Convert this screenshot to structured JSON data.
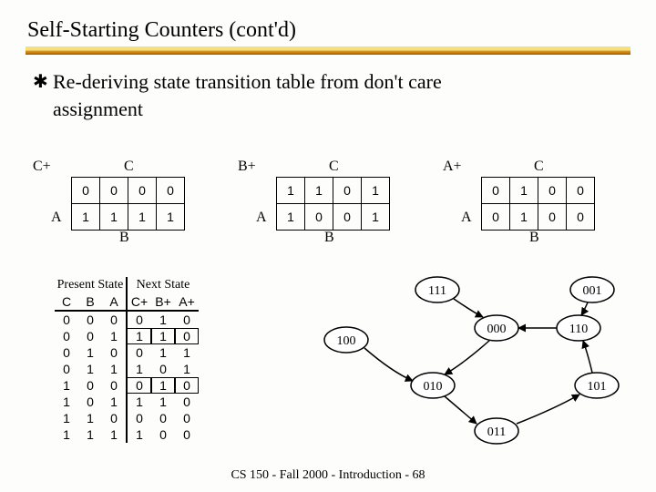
{
  "title": "Self-Starting Counters (cont'd)",
  "bullet_line1": "Re-deriving state transition table from don't care",
  "bullet_line2": "assignment",
  "kmap_labels": {
    "c": "C",
    "a": "A",
    "b": "B"
  },
  "kmaps": [
    {
      "flabel": "C+",
      "cells": [
        [
          "0",
          "0",
          "0",
          "0"
        ],
        [
          "1",
          "1",
          "1",
          "1"
        ]
      ]
    },
    {
      "flabel": "B+",
      "cells": [
        [
          "1",
          "1",
          "0",
          "1"
        ],
        [
          "1",
          "0",
          "0",
          "1"
        ]
      ]
    },
    {
      "flabel": "A+",
      "cells": [
        [
          "0",
          "1",
          "0",
          "0"
        ],
        [
          "0",
          "1",
          "0",
          "0"
        ]
      ]
    }
  ],
  "stt": {
    "group_left": "Present State",
    "group_right": "Next State",
    "headers_left": [
      "C",
      "B",
      "A"
    ],
    "headers_right": [
      "C+",
      "B+",
      "A+"
    ],
    "rows": [
      [
        "0",
        "0",
        "0",
        "0",
        "1",
        "0"
      ],
      [
        "0",
        "0",
        "1",
        "1",
        "1",
        "0"
      ],
      [
        "0",
        "1",
        "0",
        "0",
        "1",
        "1"
      ],
      [
        "0",
        "1",
        "1",
        "1",
        "0",
        "1"
      ],
      [
        "1",
        "0",
        "0",
        "0",
        "1",
        "0"
      ],
      [
        "1",
        "0",
        "1",
        "1",
        "1",
        "0"
      ],
      [
        "1",
        "1",
        "0",
        "0",
        "0",
        "0"
      ],
      [
        "1",
        "1",
        "1",
        "1",
        "0",
        "0"
      ]
    ],
    "mark_rows": [
      1,
      4
    ]
  },
  "states": {
    "n100": "100",
    "n111": "111",
    "n001": "001",
    "n000": "000",
    "n110": "110",
    "n010": "010",
    "n101": "101",
    "n011": "011"
  },
  "footer": "CS 150 - Fall 2000 - Introduction - 68",
  "chart_data": {
    "type": "table",
    "title": "Self-Starting Counters state transition",
    "kmaps": [
      {
        "output": "C+",
        "grid": [
          [
            0,
            0,
            0,
            0
          ],
          [
            1,
            1,
            1,
            1
          ]
        ]
      },
      {
        "output": "B+",
        "grid": [
          [
            1,
            1,
            0,
            1
          ],
          [
            1,
            0,
            0,
            1
          ]
        ]
      },
      {
        "output": "A+",
        "grid": [
          [
            0,
            1,
            0,
            0
          ],
          [
            0,
            1,
            0,
            0
          ]
        ]
      }
    ],
    "state_table": {
      "columns": [
        "C",
        "B",
        "A",
        "C+",
        "B+",
        "A+"
      ],
      "rows": [
        [
          0,
          0,
          0,
          0,
          1,
          0
        ],
        [
          0,
          0,
          1,
          1,
          1,
          0
        ],
        [
          0,
          1,
          0,
          0,
          1,
          1
        ],
        [
          0,
          1,
          1,
          1,
          0,
          1
        ],
        [
          1,
          0,
          0,
          0,
          1,
          0
        ],
        [
          1,
          0,
          1,
          1,
          1,
          0
        ],
        [
          1,
          1,
          0,
          0,
          0,
          0
        ],
        [
          1,
          1,
          1,
          1,
          0,
          0
        ]
      ]
    },
    "state_diagram_edges": [
      [
        "100",
        "010"
      ],
      [
        "001",
        "110"
      ],
      [
        "000",
        "010"
      ],
      [
        "010",
        "011"
      ],
      [
        "011",
        "101"
      ],
      [
        "101",
        "110"
      ],
      [
        "110",
        "000"
      ],
      [
        "111",
        "000"
      ]
    ]
  }
}
